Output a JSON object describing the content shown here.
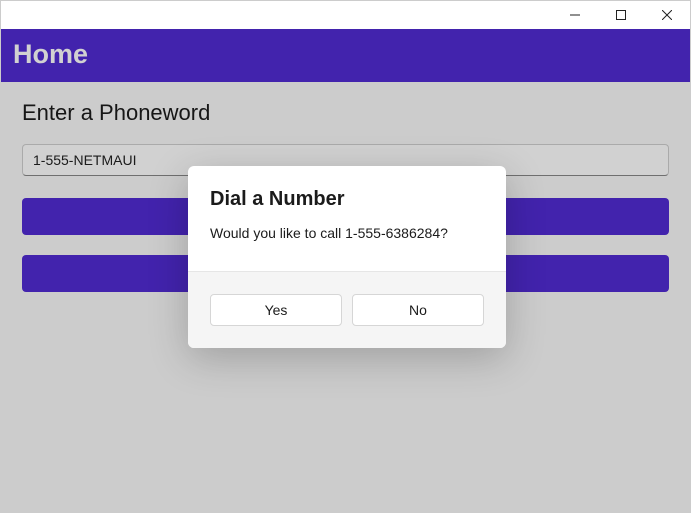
{
  "header": {
    "title": "Home"
  },
  "form": {
    "label": "Enter a Phoneword",
    "input_value": "1-555-NETMAUI"
  },
  "dialog": {
    "title": "Dial a Number",
    "message": "Would you like to call 1-555-6386284?",
    "yes_label": "Yes",
    "no_label": "No"
  }
}
